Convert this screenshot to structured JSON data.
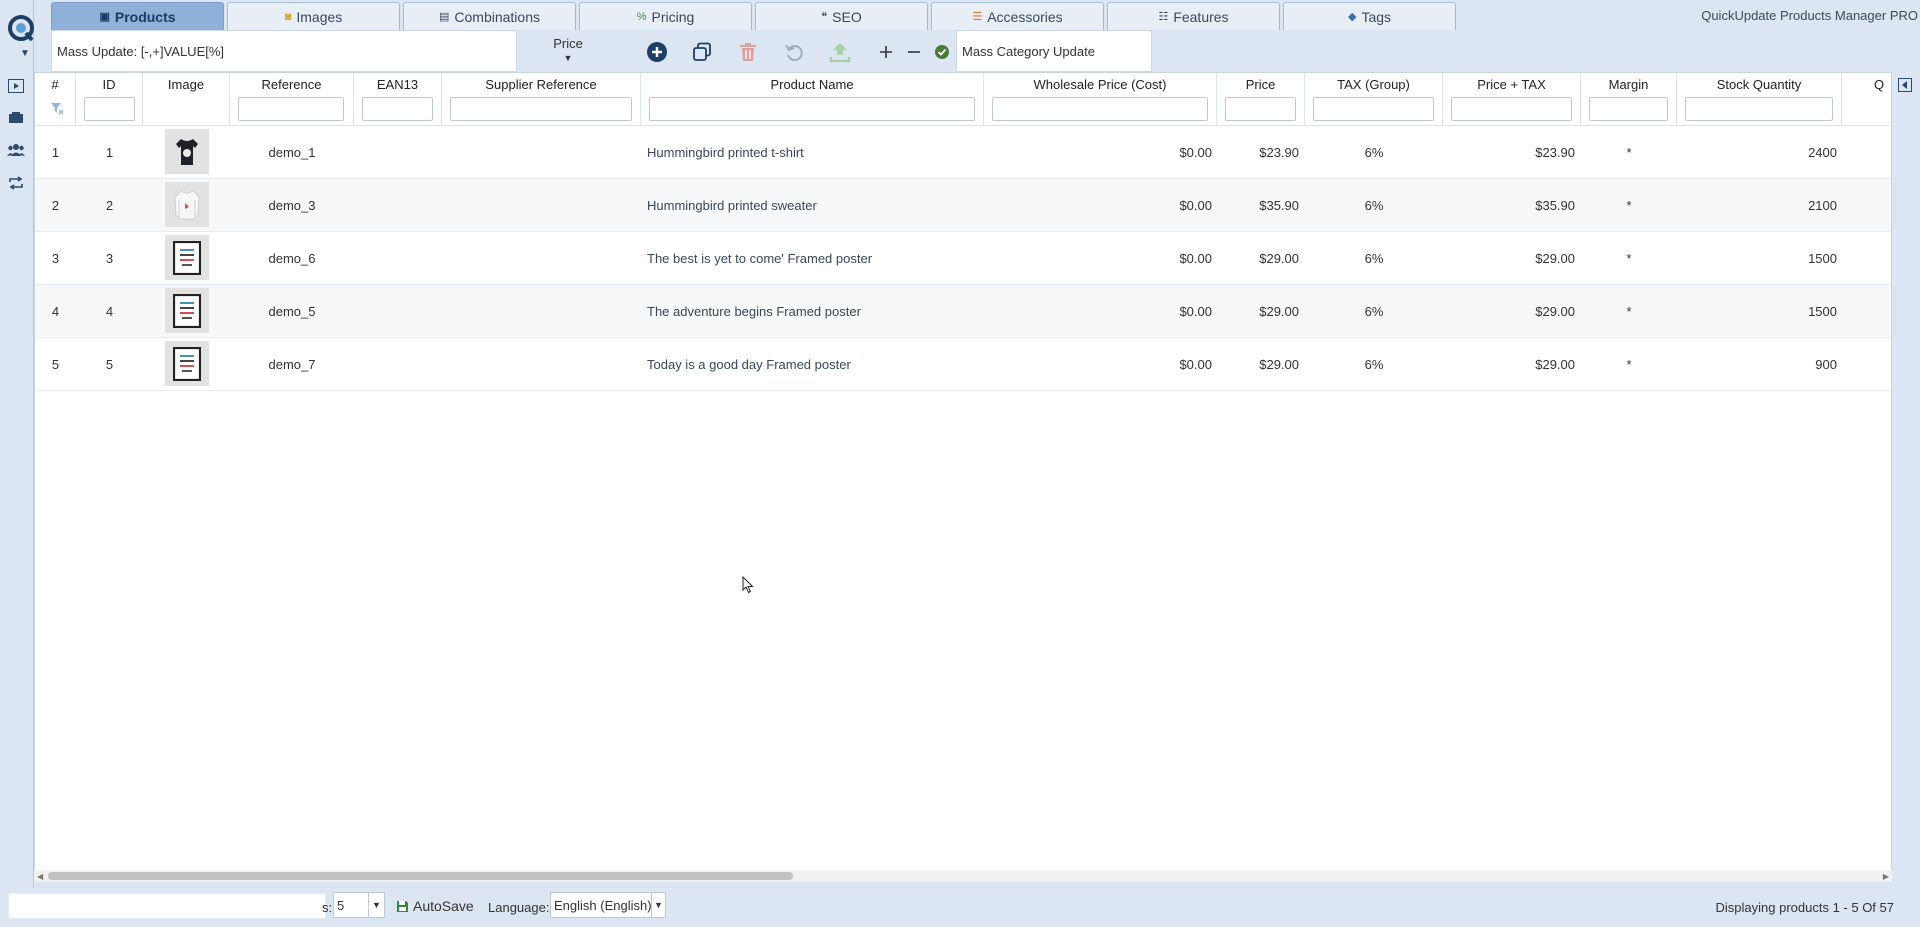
{
  "app": {
    "title": "QuickUpdate Products Manager PRO"
  },
  "tabs": [
    {
      "label": "Products",
      "icon": "boxes-icon"
    },
    {
      "label": "Images",
      "icon": "camera-icon"
    },
    {
      "label": "Combinations",
      "icon": "list-icon"
    },
    {
      "label": "Pricing",
      "icon": "percent-icon"
    },
    {
      "label": "SEO",
      "icon": "quote-icon"
    },
    {
      "label": "Accessories",
      "icon": "bars-icon"
    },
    {
      "label": "Features",
      "icon": "checklist-icon"
    },
    {
      "label": "Tags",
      "icon": "tag-icon"
    }
  ],
  "toolbar": {
    "mass_update": "Mass Update: [-,+]VALUE[%]",
    "price_select": "Price",
    "mass_category": "Mass Category Update"
  },
  "columns": {
    "num": "#",
    "id": "ID",
    "image": "Image",
    "reference": "Reference",
    "ean13": "EAN13",
    "supplier_ref": "Supplier Reference",
    "name": "Product Name",
    "wholesale": "Wholesale Price (Cost)",
    "price": "Price",
    "tax": "TAX (Group)",
    "price_tax": "Price + TAX",
    "margin": "Margin",
    "stock": "Stock Quantity",
    "next": "Q"
  },
  "rows": [
    {
      "num": "1",
      "id": "1",
      "thumb": "tshirt",
      "reference": "demo_1",
      "name": "Hummingbird printed t-shirt",
      "wholesale": "$0.00",
      "price": "$23.90",
      "tax": "6%",
      "price_tax": "$23.90",
      "margin": "*",
      "stock": "2400"
    },
    {
      "num": "2",
      "id": "2",
      "thumb": "sweater",
      "reference": "demo_3",
      "name": "Hummingbird printed sweater",
      "wholesale": "$0.00",
      "price": "$35.90",
      "tax": "6%",
      "price_tax": "$35.90",
      "margin": "*",
      "stock": "2100"
    },
    {
      "num": "3",
      "id": "3",
      "thumb": "poster",
      "reference": "demo_6",
      "name": "The best is yet to come' Framed poster",
      "wholesale": "$0.00",
      "price": "$29.00",
      "tax": "6%",
      "price_tax": "$29.00",
      "margin": "*",
      "stock": "1500"
    },
    {
      "num": "4",
      "id": "4",
      "thumb": "poster",
      "reference": "demo_5",
      "name": "The adventure begins Framed poster",
      "wholesale": "$0.00",
      "price": "$29.00",
      "tax": "6%",
      "price_tax": "$29.00",
      "margin": "*",
      "stock": "1500"
    },
    {
      "num": "5",
      "id": "5",
      "thumb": "poster",
      "reference": "demo_7",
      "name": "Today is a good day Framed poster",
      "wholesale": "$0.00",
      "price": "$29.00",
      "tax": "6%",
      "price_tax": "$29.00",
      "margin": "*",
      "stock": "900"
    }
  ],
  "footer": {
    "per_page_label": "s:",
    "per_page_value": "5",
    "autosave": "AutoSave",
    "language_label": "Language:",
    "language_value": "English (English)",
    "displaying": "Displaying products 1 - 5 Of 57"
  },
  "colors": {
    "background": "#dce6f2",
    "active_tab": "#8fb0d8",
    "add_button": "#1f3f66",
    "delete_button": "#d9a3a3",
    "save_check": "#4a7a3a",
    "autosave_icon": "#2e8b3a"
  }
}
